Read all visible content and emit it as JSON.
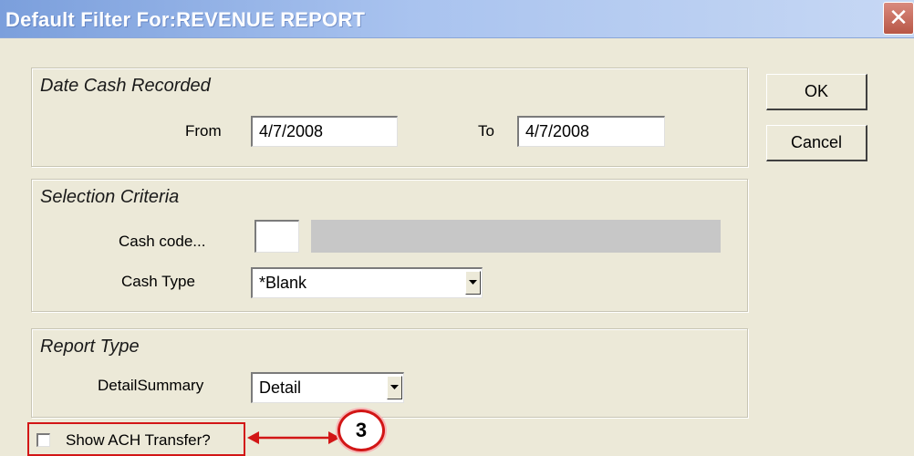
{
  "window": {
    "title": "Default Filter For:REVENUE REPORT",
    "close_icon": "close-icon"
  },
  "date_group": {
    "title": "Date Cash Recorded",
    "from_label": "From",
    "from_value": "4/7/2008",
    "to_label": "To",
    "to_value": "4/7/2008"
  },
  "selection_group": {
    "title": "Selection Criteria",
    "cash_code_label": "Cash code...",
    "cash_code_value": "",
    "cash_code_description": "",
    "cash_type_label": "Cash Type",
    "cash_type_value": "*Blank"
  },
  "report_group": {
    "title": "Report Type",
    "detail_summary_label": "DetailSummary",
    "detail_summary_value": "Detail"
  },
  "buttons": {
    "ok": "OK",
    "cancel": "Cancel"
  },
  "ach": {
    "label": "Show ACH Transfer?",
    "checked": false
  },
  "annotation": {
    "step_number": "3",
    "highlight_color": "#d21616"
  }
}
